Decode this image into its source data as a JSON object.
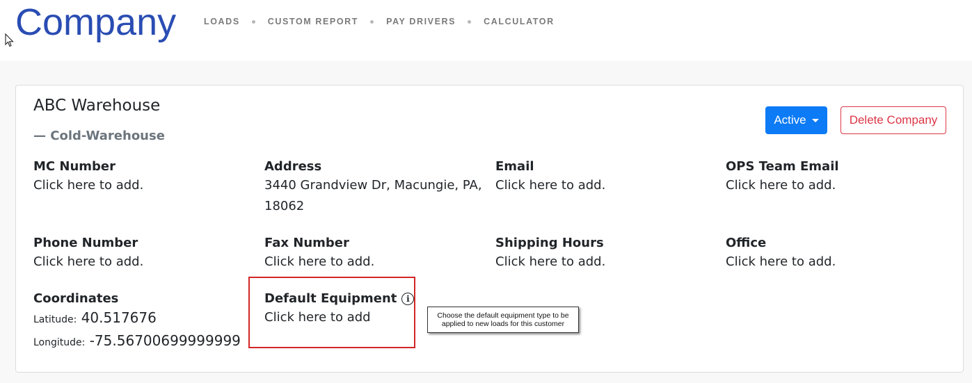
{
  "header": {
    "brand": "Company",
    "nav": [
      "LOADS",
      "CUSTOM REPORT",
      "PAY DRIVERS",
      "CALCULATOR"
    ]
  },
  "company": {
    "name": "ABC Warehouse",
    "subtitle": "— Cold-Warehouse",
    "status_button": "Active",
    "delete_button": "Delete Company"
  },
  "fields": {
    "mc_number": {
      "label": "MC Number",
      "value": "Click here to add."
    },
    "address": {
      "label": "Address",
      "value": "3440 Grandview Dr, Macungie, PA, 18062"
    },
    "email": {
      "label": "Email",
      "value": "Click here to add."
    },
    "ops_email": {
      "label": "OPS Team Email",
      "value": "Click here to add."
    },
    "phone": {
      "label": "Phone Number",
      "value": "Click here to add."
    },
    "fax": {
      "label": "Fax Number",
      "value": "Click here to add."
    },
    "shipping_hours": {
      "label": "Shipping Hours",
      "value": "Click here to add."
    },
    "office": {
      "label": "Office",
      "value": "Click here to add."
    },
    "coordinates": {
      "label": "Coordinates",
      "latitude_label": "Latitude:",
      "latitude": "40.517676",
      "longitude_label": "Longitude:",
      "longitude": "-75.56700699999999"
    },
    "default_equipment": {
      "label": "Default Equipment",
      "value": "Click here to add",
      "tooltip": "Choose the default equipment type to be applied to new loads for this customer"
    }
  },
  "colors": {
    "brand": "#2a4db3",
    "primary": "#0d7bf5",
    "danger": "#dc3545",
    "highlight": "#d32626"
  },
  "icons": {
    "info": "info-icon",
    "cursor": "cursor-icon",
    "caret": "caret-down-icon"
  }
}
